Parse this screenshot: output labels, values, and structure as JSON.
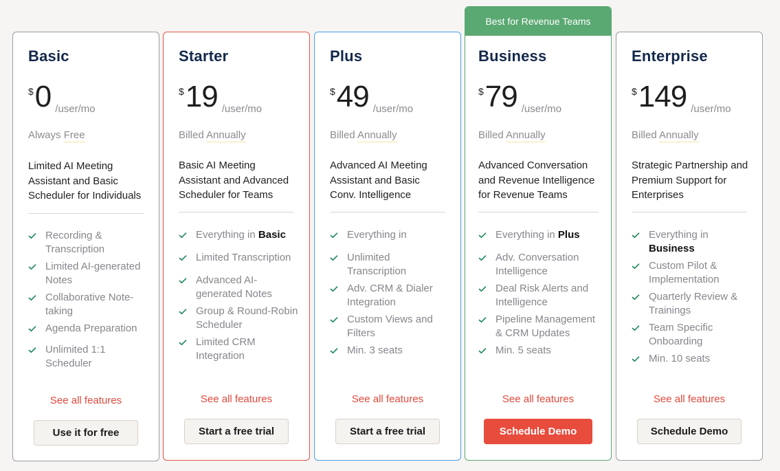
{
  "colors": {
    "background": "#f6f5f3",
    "heading": "#13294b",
    "accent_red": "#e84c3d",
    "accent_green": "#5aa872",
    "accent_blue": "#4a9ee6",
    "check": "#1e8a5a"
  },
  "plans": [
    {
      "name": "Basic",
      "currency": "$",
      "price": "0",
      "per": "/user/mo",
      "billing_prefix": "Always ",
      "billing_underlined": "Free",
      "description": "Limited AI Meeting Assistant and Basic Scheduler for Individuals",
      "features": [
        {
          "text": "Recording & Transcription",
          "bold": ""
        },
        {
          "text": "Limited AI-generated Notes",
          "bold": ""
        },
        {
          "text": "Collaborative Note-taking",
          "bold": ""
        },
        {
          "text": "Agenda Preparation",
          "bold": ""
        },
        {
          "text": "Unlimited 1:1 Scheduler",
          "bold": ""
        }
      ],
      "see_all": "See all features",
      "cta": "Use it for free"
    },
    {
      "name": "Starter",
      "currency": "$",
      "price": "19",
      "per": "/user/mo",
      "billing_prefix": "Billed ",
      "billing_underlined": "Annually",
      "description": "Basic AI Meeting Assistant and Advanced Scheduler for Teams",
      "features": [
        {
          "text": "Everything in ",
          "bold": "Basic"
        },
        {
          "text": "Limited Transcription",
          "bold": ""
        },
        {
          "text": "Advanced AI-generated Notes",
          "bold": ""
        },
        {
          "text": "Group & Round-Robin Scheduler",
          "bold": ""
        },
        {
          "text": "Limited CRM Integration",
          "bold": ""
        }
      ],
      "see_all": "See all features",
      "cta": "Start a free trial"
    },
    {
      "name": "Plus",
      "currency": "$",
      "price": "49",
      "per": "/user/mo",
      "billing_prefix": "Billed ",
      "billing_underlined": "Annually",
      "description": "Advanced AI Meeting Assistant and Basic Conv. Intelligence",
      "features": [
        {
          "text": "Everything in",
          "bold": ""
        },
        {
          "text": "Unlimited Transcription",
          "bold": ""
        },
        {
          "text": "Adv. CRM & Dialer Integration",
          "bold": ""
        },
        {
          "text": "Custom Views and Filters",
          "bold": ""
        },
        {
          "text": "Min. 3 seats",
          "bold": ""
        }
      ],
      "see_all": "See all features",
      "cta": "Start a free trial"
    },
    {
      "badge": "Best for Revenue Teams",
      "name": "Business",
      "currency": "$",
      "price": "79",
      "per": "/user/mo",
      "billing_prefix": "Billed ",
      "billing_underlined": "Annually",
      "description": "Advanced Conversation and Revenue Intelligence for Revenue Teams",
      "features": [
        {
          "text": "Everything in ",
          "bold": "Plus"
        },
        {
          "text": "Adv. Conversation Intelligence",
          "bold": ""
        },
        {
          "text": "Deal Risk Alerts and Intelligence",
          "bold": ""
        },
        {
          "text": "Pipeline Management & CRM Updates",
          "bold": ""
        },
        {
          "text": "Min. 5 seats",
          "bold": ""
        }
      ],
      "see_all": "See all features",
      "cta": "Schedule Demo"
    },
    {
      "name": "Enterprise",
      "currency": "$",
      "price": "149",
      "per": "/user/mo",
      "billing_prefix": "Billed ",
      "billing_underlined": "Annually",
      "description": "Strategic Partnership and Premium Support for Enterprises",
      "features": [
        {
          "text": "Everything in ",
          "bold": "Business"
        },
        {
          "text": "Custom Pilot & Implementation",
          "bold": ""
        },
        {
          "text": "Quarterly Review & Trainings",
          "bold": ""
        },
        {
          "text": "Team Specific Onboarding",
          "bold": ""
        },
        {
          "text": "Min. 10 seats",
          "bold": ""
        }
      ],
      "see_all": "See all features",
      "cta": "Schedule Demo"
    }
  ]
}
